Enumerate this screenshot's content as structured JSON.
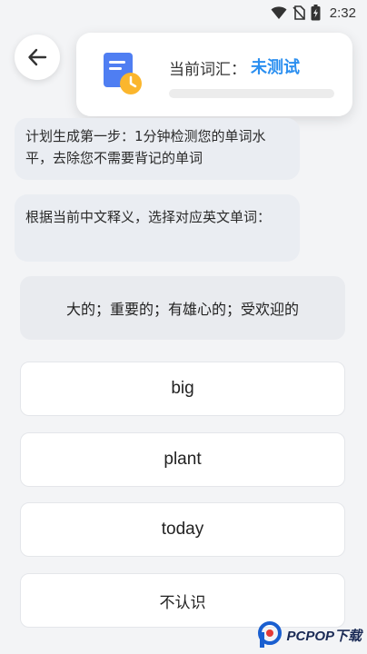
{
  "status_bar": {
    "time": "2:32"
  },
  "level_card": {
    "label": "当前词汇：",
    "value": "未测试",
    "progress": 0
  },
  "messages": [
    "计划生成第一步：1分钟检测您的单词水平，去除您不需要背记的单词",
    "根据当前中文释义，选择对应英文单词："
  ],
  "question": {
    "meaning": "大的；重要的；有雄心的；受欢迎的"
  },
  "options": [
    "big",
    "plant",
    "today",
    "不认识"
  ],
  "watermark": {
    "text": "PCPOP下载"
  },
  "colors": {
    "accent": "#2b8ff0",
    "background": "#f3f4f6"
  },
  "icons": {
    "back": "arrow-left-icon",
    "card": "document-clock-icon"
  }
}
